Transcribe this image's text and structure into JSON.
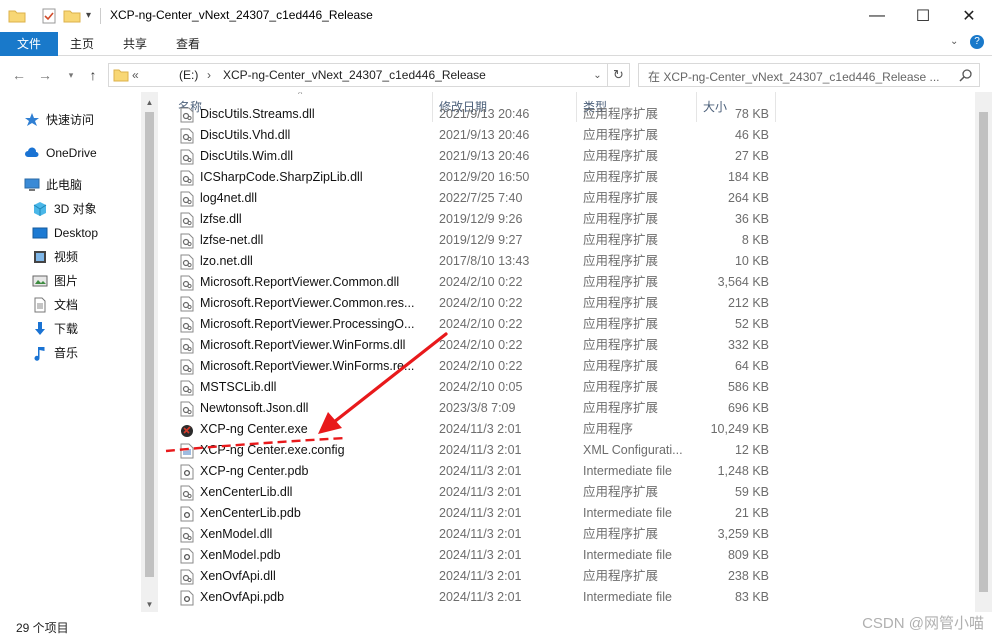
{
  "window": {
    "title": "XCP-ng-Center_vNext_24307_c1ed446_Release",
    "controls": {
      "minimize": "—",
      "maximize": "☐",
      "close": "✕"
    }
  },
  "ribbon": {
    "tabs": [
      "文件",
      "主页",
      "共享",
      "查看"
    ],
    "active_tab": "文件"
  },
  "address": {
    "overflow": "«",
    "drive": "(E:)",
    "sep": "›",
    "folder": "XCP-ng-Center_vNext_24307_c1ed446_Release",
    "search_placeholder": "在 XCP-ng-Center_vNext_24307_c1ed446_Release ..."
  },
  "sidebar": {
    "items": [
      {
        "label": "快速访问",
        "icon": "star-icon"
      },
      {
        "label": "OneDrive",
        "icon": "cloud-icon"
      },
      {
        "label": "此电脑",
        "icon": "computer-icon"
      },
      {
        "label": "3D 对象",
        "icon": "cube-icon"
      },
      {
        "label": "Desktop",
        "icon": "desktop-icon"
      },
      {
        "label": "视频",
        "icon": "video-icon"
      },
      {
        "label": "图片",
        "icon": "picture-icon"
      },
      {
        "label": "文档",
        "icon": "document-icon"
      },
      {
        "label": "下载",
        "icon": "download-icon"
      },
      {
        "label": "音乐",
        "icon": "music-icon"
      }
    ]
  },
  "columns": {
    "name": "名称",
    "date": "修改日期",
    "type": "类型",
    "size": "大小"
  },
  "files": [
    {
      "name": "DiscUtils.Streams.dll",
      "date": "2021/9/13 20:46",
      "type": "应用程序扩展",
      "size": "78 KB",
      "icon": "dll"
    },
    {
      "name": "DiscUtils.Vhd.dll",
      "date": "2021/9/13 20:46",
      "type": "应用程序扩展",
      "size": "46 KB",
      "icon": "dll"
    },
    {
      "name": "DiscUtils.Wim.dll",
      "date": "2021/9/13 20:46",
      "type": "应用程序扩展",
      "size": "27 KB",
      "icon": "dll"
    },
    {
      "name": "ICSharpCode.SharpZipLib.dll",
      "date": "2012/9/20 16:50",
      "type": "应用程序扩展",
      "size": "184 KB",
      "icon": "dll"
    },
    {
      "name": "log4net.dll",
      "date": "2022/7/25 7:40",
      "type": "应用程序扩展",
      "size": "264 KB",
      "icon": "dll"
    },
    {
      "name": "lzfse.dll",
      "date": "2019/12/9 9:26",
      "type": "应用程序扩展",
      "size": "36 KB",
      "icon": "dll"
    },
    {
      "name": "lzfse-net.dll",
      "date": "2019/12/9 9:27",
      "type": "应用程序扩展",
      "size": "8 KB",
      "icon": "dll"
    },
    {
      "name": "lzo.net.dll",
      "date": "2017/8/10 13:43",
      "type": "应用程序扩展",
      "size": "10 KB",
      "icon": "dll"
    },
    {
      "name": "Microsoft.ReportViewer.Common.dll",
      "date": "2024/2/10 0:22",
      "type": "应用程序扩展",
      "size": "3,564 KB",
      "icon": "dll"
    },
    {
      "name": "Microsoft.ReportViewer.Common.res...",
      "date": "2024/2/10 0:22",
      "type": "应用程序扩展",
      "size": "212 KB",
      "icon": "dll"
    },
    {
      "name": "Microsoft.ReportViewer.ProcessingO...",
      "date": "2024/2/10 0:22",
      "type": "应用程序扩展",
      "size": "52 KB",
      "icon": "dll"
    },
    {
      "name": "Microsoft.ReportViewer.WinForms.dll",
      "date": "2024/2/10 0:22",
      "type": "应用程序扩展",
      "size": "332 KB",
      "icon": "dll"
    },
    {
      "name": "Microsoft.ReportViewer.WinForms.re...",
      "date": "2024/2/10 0:22",
      "type": "应用程序扩展",
      "size": "64 KB",
      "icon": "dll"
    },
    {
      "name": "MSTSCLib.dll",
      "date": "2024/2/10 0:05",
      "type": "应用程序扩展",
      "size": "586 KB",
      "icon": "dll"
    },
    {
      "name": "Newtonsoft.Json.dll",
      "date": "2023/3/8 7:09",
      "type": "应用程序扩展",
      "size": "696 KB",
      "icon": "dll"
    },
    {
      "name": "XCP-ng Center.exe",
      "date": "2024/11/3 2:01",
      "type": "应用程序",
      "size": "10,249 KB",
      "icon": "exe"
    },
    {
      "name": "XCP-ng Center.exe.config",
      "date": "2024/11/3 2:01",
      "type": "XML Configurati...",
      "size": "12 KB",
      "icon": "config"
    },
    {
      "name": "XCP-ng Center.pdb",
      "date": "2024/11/3 2:01",
      "type": "Intermediate file",
      "size": "1,248 KB",
      "icon": "pdb"
    },
    {
      "name": "XenCenterLib.dll",
      "date": "2024/11/3 2:01",
      "type": "应用程序扩展",
      "size": "59 KB",
      "icon": "dll"
    },
    {
      "name": "XenCenterLib.pdb",
      "date": "2024/11/3 2:01",
      "type": "Intermediate file",
      "size": "21 KB",
      "icon": "pdb"
    },
    {
      "name": "XenModel.dll",
      "date": "2024/11/3 2:01",
      "type": "应用程序扩展",
      "size": "3,259 KB",
      "icon": "dll"
    },
    {
      "name": "XenModel.pdb",
      "date": "2024/11/3 2:01",
      "type": "Intermediate file",
      "size": "809 KB",
      "icon": "pdb"
    },
    {
      "name": "XenOvfApi.dll",
      "date": "2024/11/3 2:01",
      "type": "应用程序扩展",
      "size": "238 KB",
      "icon": "dll"
    },
    {
      "name": "XenOvfApi.pdb",
      "date": "2024/11/3 2:01",
      "type": "Intermediate file",
      "size": "83 KB",
      "icon": "pdb"
    }
  ],
  "status": {
    "item_count": "29 个项目"
  },
  "watermark": "CSDN @网管小喵",
  "colors": {
    "accent": "#1979ca",
    "annotation": "#e8191b",
    "header_text": "#4c607a"
  }
}
